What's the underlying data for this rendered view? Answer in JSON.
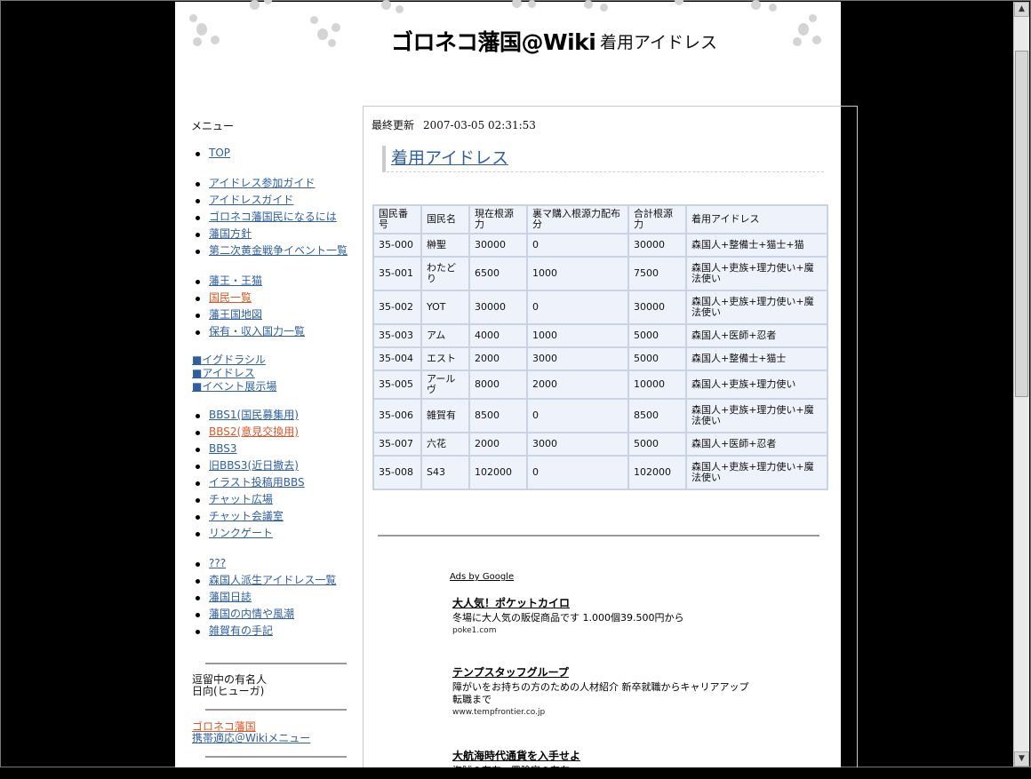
{
  "header": {
    "site_title": "ゴロネコ藩国@Wiki",
    "page_subtitle": "着用アイドレス"
  },
  "sidebar": {
    "menu_title": "メニュー",
    "group1": [
      {
        "label": "TOP"
      }
    ],
    "group2": [
      {
        "label": "アイドレス参加ガイド"
      },
      {
        "label": "アイドレスガイド"
      },
      {
        "label": "ゴロネコ藩国民になるには"
      },
      {
        "label": "藩国方針"
      },
      {
        "label": "第二次黄金戦争イベント一覧"
      }
    ],
    "group3": [
      {
        "label": "藩王・王猫"
      },
      {
        "label": "国民一覧"
      },
      {
        "label": "藩王国地図"
      },
      {
        "label": "保有・収入国力一覧"
      }
    ],
    "square_links": [
      {
        "label": "■イグドラシル"
      },
      {
        "label": "■アイドレス"
      },
      {
        "label": "■イベント展示場"
      }
    ],
    "group4": [
      {
        "label": "BBS1(国民募集用)"
      },
      {
        "label": "BBS2(意見交換用)"
      },
      {
        "label": "BBS3"
      },
      {
        "label": "旧BBS3(近日撤去)"
      },
      {
        "label": "イラスト投稿用BBS"
      },
      {
        "label": "チャット広場"
      },
      {
        "label": "チャット会議室"
      },
      {
        "label": "リンクゲート"
      }
    ],
    "group5": [
      {
        "label": "???"
      },
      {
        "label": "森国人派生アイドレス一覧"
      },
      {
        "label": "藩国日誌"
      },
      {
        "label": "藩国の内情や風潮"
      },
      {
        "label": "雑賀有の手記"
      }
    ],
    "staying_title": "逗留中の有名人",
    "staying_name": "日向(ヒューガ)",
    "footer_link1": "ゴロネコ藩国",
    "footer_link2": "携帯適応＠Wikiメニュー"
  },
  "content": {
    "last_updated_label": "最終更新",
    "last_updated_value": "2007-03-05 02:31:53",
    "heading": "着用アイドレス",
    "table": {
      "headers": [
        "国民番号",
        "国民名",
        "現在根源力",
        "裏マ購入根源力配布分",
        "合計根源力",
        "着用アイドレス"
      ],
      "rows": [
        [
          "35-000",
          "榊聖",
          "30000",
          "0",
          "30000",
          "森国人+整備士+猫士+猫"
        ],
        [
          "35-001",
          "わたどり",
          "6500",
          "1000",
          "7500",
          "森国人+吏族+理力使い+魔法使い"
        ],
        [
          "35-002",
          "YOT",
          "30000",
          "0",
          "30000",
          "森国人+吏族+理力使い+魔法使い"
        ],
        [
          "35-003",
          "アム",
          "4000",
          "1000",
          "5000",
          "森国人+医師+忍者"
        ],
        [
          "35-004",
          "エスト",
          "2000",
          "3000",
          "5000",
          "森国人+整備士+猫士"
        ],
        [
          "35-005",
          "アールヴ",
          "8000",
          "2000",
          "10000",
          "森国人+吏族+理力使い"
        ],
        [
          "35-006",
          "雑賀有",
          "8500",
          "0",
          "8500",
          "森国人+吏族+理力使い+魔法使い"
        ],
        [
          "35-007",
          "六花",
          "2000",
          "3000",
          "5000",
          "森国人+医師+忍者"
        ],
        [
          "35-008",
          "S43",
          "102000",
          "0",
          "102000",
          "森国人+吏族+理力使い+魔法使い"
        ]
      ]
    }
  },
  "ads": {
    "ads_by": "Ads by Google",
    "items": [
      {
        "title": "大人気！ポケットカイロ",
        "text": "冬場に大人気の販促商品です 1.000個39.500円から",
        "url": "poke1.com"
      },
      {
        "title": "テンプスタッフグループ",
        "text": "障がいをお持ちの方のための人材紹介 新卒就職からキャリアアップ転職まで",
        "url": "www.tempfrontier.co.jp"
      },
      {
        "title": "大航海時代通貨を入手せよ",
        "text": "海賊の存在、冒険家の存在...",
        "url": ""
      }
    ]
  },
  "colors": {
    "link": "#2e5fa0",
    "visited": "#d9582a",
    "table_bg": "#eef3fb",
    "table_border": "#c9d3e2"
  }
}
